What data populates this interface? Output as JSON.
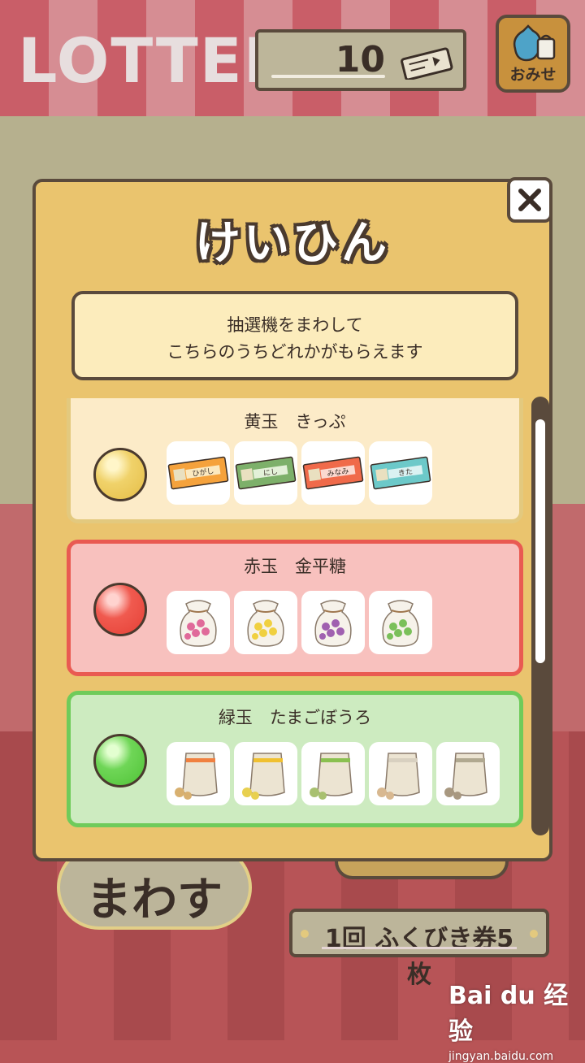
{
  "header": {
    "title": "LOTTERY",
    "ticket_count": "10",
    "shop_label": "おみせ"
  },
  "bottom": {
    "spin_label": "まわす",
    "cost_text": "1回 ふくびき券5枚"
  },
  "watermark": {
    "logo": "Bai du 经验",
    "url": "jingyan.baidu.com"
  },
  "modal": {
    "title": "けいひん",
    "info_lines": [
      "抽選機をまわして",
      "こちらのうちどれかがもらえます"
    ],
    "groups": [
      {
        "title": "黄玉　きっぷ",
        "ball_color": "#f0d26a",
        "items": [
          {
            "icon": "ticket-icon",
            "color": "#f5a23c",
            "label": "ひがし"
          },
          {
            "icon": "ticket-icon",
            "color": "#7db06a",
            "label": "にし"
          },
          {
            "icon": "ticket-icon",
            "color": "#f06a4a",
            "label": "みなみ"
          },
          {
            "icon": "ticket-icon",
            "color": "#6cc9c9",
            "label": "きた"
          }
        ]
      },
      {
        "title": "赤玉　金平糖",
        "ball_color": "#f05a4f",
        "items": [
          {
            "icon": "candy-bag-icon",
            "color": "#e06a9a"
          },
          {
            "icon": "candy-bag-icon",
            "color": "#f0d040"
          },
          {
            "icon": "candy-bag-icon",
            "color": "#a060b0"
          },
          {
            "icon": "candy-bag-icon",
            "color": "#7ac05a"
          }
        ]
      },
      {
        "title": "緑玉　たまごぼうろ",
        "ball_color": "#6fd657",
        "items": [
          {
            "icon": "snack-bag-icon",
            "color": "#f08040"
          },
          {
            "icon": "snack-bag-icon",
            "color": "#f0c030"
          },
          {
            "icon": "snack-bag-icon",
            "color": "#8ac050"
          },
          {
            "icon": "snack-bag-icon",
            "color": "#d8d0c0"
          },
          {
            "icon": "snack-bag-icon",
            "color": "#b0a890"
          }
        ]
      }
    ]
  }
}
